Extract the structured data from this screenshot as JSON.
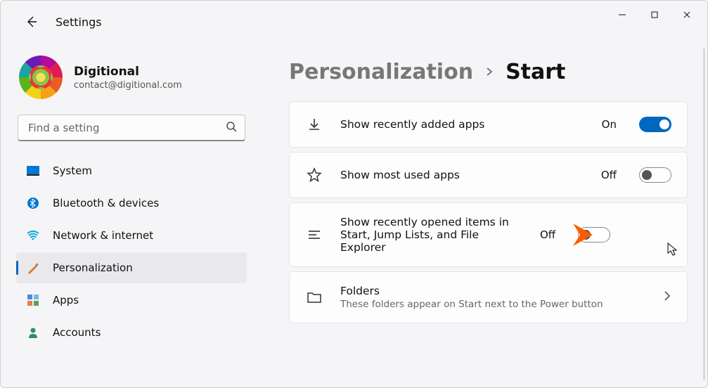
{
  "window": {
    "app_title": "Settings"
  },
  "profile": {
    "name": "Digitional",
    "email": "contact@digitional.com"
  },
  "search": {
    "placeholder": "Find a setting"
  },
  "sidebar": {
    "items": [
      {
        "icon": "system",
        "label": "System"
      },
      {
        "icon": "bluetooth",
        "label": "Bluetooth & devices"
      },
      {
        "icon": "network",
        "label": "Network & internet"
      },
      {
        "icon": "personalization",
        "label": "Personalization"
      },
      {
        "icon": "apps",
        "label": "Apps"
      },
      {
        "icon": "accounts",
        "label": "Accounts"
      }
    ],
    "active_index": 3
  },
  "breadcrumb": {
    "parent": "Personalization",
    "current": "Start"
  },
  "settings": [
    {
      "icon": "download",
      "title": "Show recently added apps",
      "state_label": "On",
      "state": true,
      "type": "toggle"
    },
    {
      "icon": "star",
      "title": "Show most used apps",
      "state_label": "Off",
      "state": false,
      "type": "toggle"
    },
    {
      "icon": "list",
      "title": "Show recently opened items in Start, Jump Lists, and File Explorer",
      "state_label": "Off",
      "state": false,
      "type": "toggle",
      "annotation_arrow": true,
      "cursor": true
    },
    {
      "icon": "folder",
      "title": "Folders",
      "subtitle": "These folders appear on Start next to the Power button",
      "type": "link"
    }
  ]
}
